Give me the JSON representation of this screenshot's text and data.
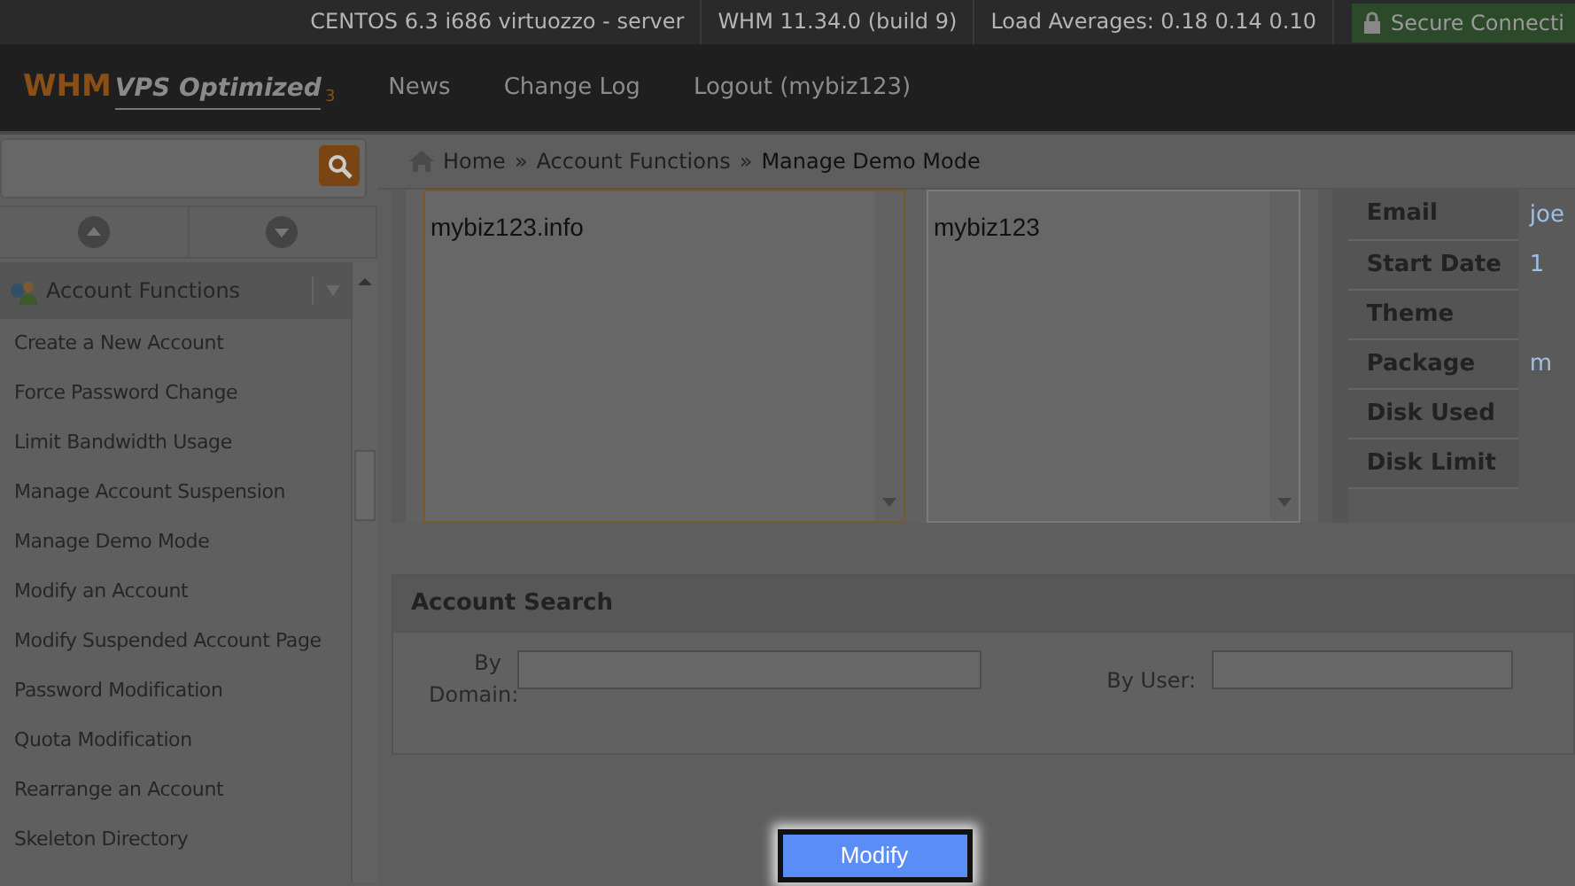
{
  "top_bar": {
    "items": [
      "CENTOS 6.3 i686 virtuozzo - server",
      "WHM 11.34.0 (build 9)",
      "Load Averages: 0.18 0.14 0.10"
    ],
    "secure": "Secure Connecti"
  },
  "logo": {
    "main": "WHM",
    "sub": "VPS Optimized",
    "index": "3"
  },
  "nav": [
    "News",
    "Change Log",
    "Logout (mybiz123)"
  ],
  "sidebar": {
    "group": "Account Functions",
    "items": [
      "Create a New Account",
      "Force Password Change",
      "Limit Bandwidth Usage",
      "Manage Account Suspension",
      "Manage Demo Mode",
      "Modify an Account",
      "Modify Suspended Account Page",
      "Password Modification",
      "Quota Modification",
      "Rearrange an Account",
      "Skeleton Directory"
    ]
  },
  "breadcrumb": [
    {
      "kind": "link",
      "text": "Home"
    },
    {
      "kind": "separator",
      "text": "»"
    },
    {
      "kind": "link",
      "text": "Account Functions"
    },
    {
      "kind": "separator",
      "text": "»"
    },
    {
      "kind": "current",
      "text": "Manage Demo Mode"
    }
  ],
  "domain_list": [
    "mybiz123.info"
  ],
  "user_list": [
    "mybiz123"
  ],
  "account_info": [
    {
      "label": "Email",
      "value": "joe"
    },
    {
      "label": "Start Date",
      "value": "1"
    },
    {
      "label": "Theme"
    },
    {
      "label": "Package",
      "value": "m"
    },
    {
      "label": "Disk Used"
    },
    {
      "label": "Disk Limit"
    }
  ],
  "account_search": {
    "title": "Account Search",
    "fields": [
      {
        "label": "By Domain:"
      },
      {
        "label": "By User:"
      }
    ]
  },
  "button": "Modify"
}
